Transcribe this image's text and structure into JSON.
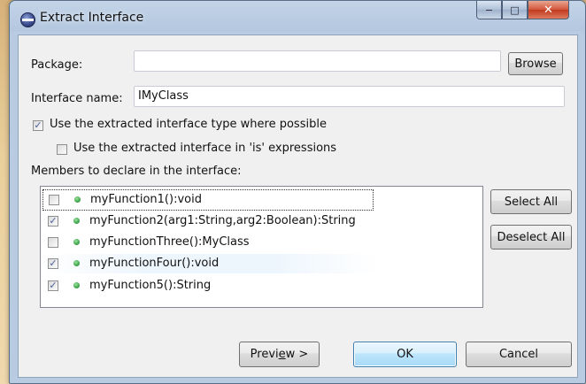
{
  "window": {
    "title": "Extract Interface",
    "minimize": "−",
    "maximize": "□",
    "close": "✕"
  },
  "form": {
    "package_label": "Package:",
    "package_value": "",
    "browse_label": "Browse",
    "interface_name_label": "Interface name:",
    "interface_name_value": "IMyClass",
    "use_extracted_label": "Use the extracted interface type where possible",
    "use_extracted_checked": true,
    "use_in_is_label": "Use the extracted interface in 'is' expressions",
    "use_in_is_checked": false,
    "members_label": "Members to declare in the interface:"
  },
  "members": [
    {
      "name": "myFunction1():void",
      "checked": false
    },
    {
      "name": "myFunction2(arg1:String,arg2:Boolean):String",
      "checked": true
    },
    {
      "name": "myFunctionThree():MyClass",
      "checked": false
    },
    {
      "name": "myFunctionFour():void",
      "checked": true
    },
    {
      "name": "myFunction5():String",
      "checked": true
    }
  ],
  "side_buttons": {
    "select_all": "Select All",
    "deselect_all": "Deselect All"
  },
  "footer": {
    "preview_prefix": "Previ",
    "preview_mnemonic": "e",
    "preview_suffix": "w >",
    "ok": "OK",
    "cancel": "Cancel"
  },
  "icons": {
    "check": "✓",
    "member": "member-dot-icon"
  },
  "colors": {
    "member_dot": "#3da54b",
    "check_mark": "#4a5f97",
    "default_button_border": "#3c7fb1"
  }
}
